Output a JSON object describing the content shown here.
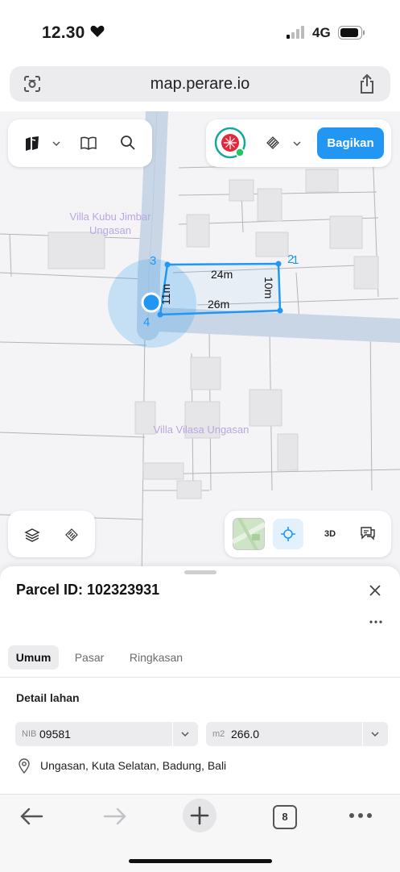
{
  "status_bar": {
    "time": "12.30",
    "network": "4G"
  },
  "browser": {
    "url": "map.perare.io"
  },
  "map": {
    "place_labels": [
      "Villa Kubu Jimbar",
      "Ungasan",
      "Villa Vilasa Ungasan"
    ],
    "parcel": {
      "side_labels": {
        "top": "24m",
        "bottom": "26m",
        "left": "11m",
        "right": "10m"
      },
      "vertex_labels": [
        "1",
        "2",
        "3",
        "4"
      ]
    },
    "colors": {
      "parcel_stroke": "#2196f3",
      "road": "#c9d6e6",
      "accent": "#2196f3"
    }
  },
  "toolbar": {
    "share_label": "Bagikan",
    "icons": [
      "map-style-icon",
      "chevron-down-icon",
      "book-icon",
      "search-icon",
      "avatar",
      "measure-icon",
      "chevron-down-icon"
    ]
  },
  "map_controls": {
    "mode_3d": "3D",
    "icons": [
      "layers-icon",
      "measure-icon",
      "satellite-thumbnail",
      "locate-icon",
      "feedback-icon"
    ]
  },
  "sheet": {
    "title": "Parcel ID: 102323931",
    "tabs": [
      "Umum",
      "Pasar",
      "Ringkasan"
    ],
    "active_tab": "Umum",
    "section_title": "Detail lahan",
    "nib": {
      "label": "NIB",
      "value": "09581"
    },
    "area": {
      "label": "m2",
      "value": "266.0"
    },
    "address": "Ungasan, Kuta Selatan, Badung, Bali"
  },
  "bottom_bar": {
    "tab_count": "8"
  }
}
